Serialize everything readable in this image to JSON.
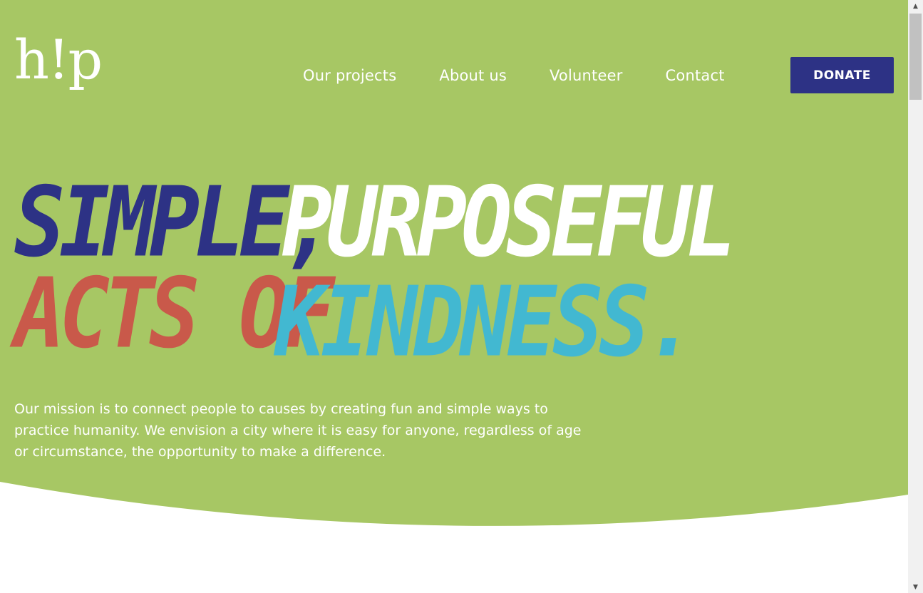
{
  "brand": {
    "logo_text": "h!p",
    "colors": {
      "hero_green": "#a7c764",
      "navy": "#2d3285",
      "coral": "#c9594a",
      "teal": "#42b8d1",
      "white": "#ffffff"
    }
  },
  "nav": {
    "items": [
      {
        "label": "Our projects"
      },
      {
        "label": "About us"
      },
      {
        "label": "Volunteer"
      },
      {
        "label": "Contact"
      }
    ],
    "donate_label": "DONATE"
  },
  "hero": {
    "headline": {
      "line1_part1": "SIMPLE,",
      "line1_part2": "PURPOSEFUL",
      "line2_part1": "ACTS OF",
      "line2_part2": "KINDNESS."
    },
    "mission": "Our mission is to connect people to causes by creating fun and simple ways to practice humanity. We envision a city where it is easy for anyone, regardless of age or circumstance, the opportunity to make a difference."
  },
  "scrollbar": {
    "up_icon": "arrow-up-icon",
    "down_icon": "arrow-down-icon"
  }
}
